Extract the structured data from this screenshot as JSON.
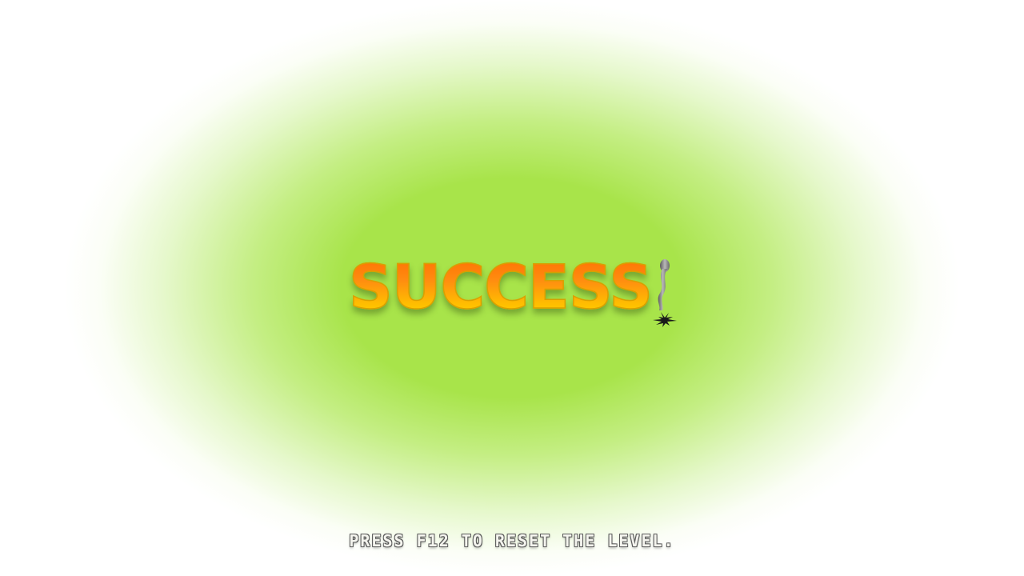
{
  "screen": {
    "title": "SUCCESS",
    "hint": "PRESS F12 TO RESET THE LEVEL.",
    "mark_icon": "exclamation-sprout-icon"
  },
  "colors": {
    "background_glow": "#a8e44a",
    "title_top": "#ff6a00",
    "title_bottom": "#ffd800",
    "hint_text": "#f4f4ee"
  }
}
